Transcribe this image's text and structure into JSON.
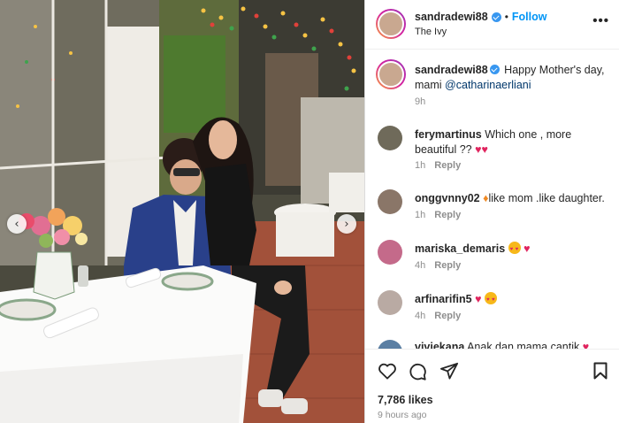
{
  "post": {
    "username": "sandradewi88",
    "follow_label": "Follow",
    "dot": "•",
    "location": "The Ivy",
    "more_label": "•••",
    "caption_text": "Happy Mother's day, mami",
    "caption_mention": "@catharinaerliani",
    "caption_time": "9h",
    "likes": "7,786 likes",
    "posted_ago": "9 hours ago",
    "accent_color": "#0095f6"
  },
  "nav": {
    "prev_icon": "‹",
    "next_icon": "›"
  },
  "comments": [
    {
      "username": "ferymartinus",
      "text": "Which one , more beautiful ??",
      "time": "1h",
      "reply": "Reply",
      "avatar_color": "#6f6a5a"
    },
    {
      "username": "onggvnny02",
      "text": "like mom .like daughter.",
      "time": "1h",
      "reply": "Reply",
      "avatar_color": "#8a7668"
    },
    {
      "username": "mariska_demaris",
      "text": "",
      "time": "4h",
      "reply": "Reply",
      "avatar_color": "#c46a8a"
    },
    {
      "username": "arfinarifin5",
      "text": "",
      "time": "4h",
      "reply": "Reply",
      "avatar_color": "#b9aaa3"
    }
  ],
  "partial_comment": {
    "username": "viviekana",
    "text": "Anak dan mama cantik"
  },
  "icons": [
    "heart-icon",
    "comment-icon",
    "share-icon",
    "bookmark-icon",
    "verified-icon",
    "fire-emoji",
    "heart-emoji",
    "heart-eyes-emoji"
  ]
}
